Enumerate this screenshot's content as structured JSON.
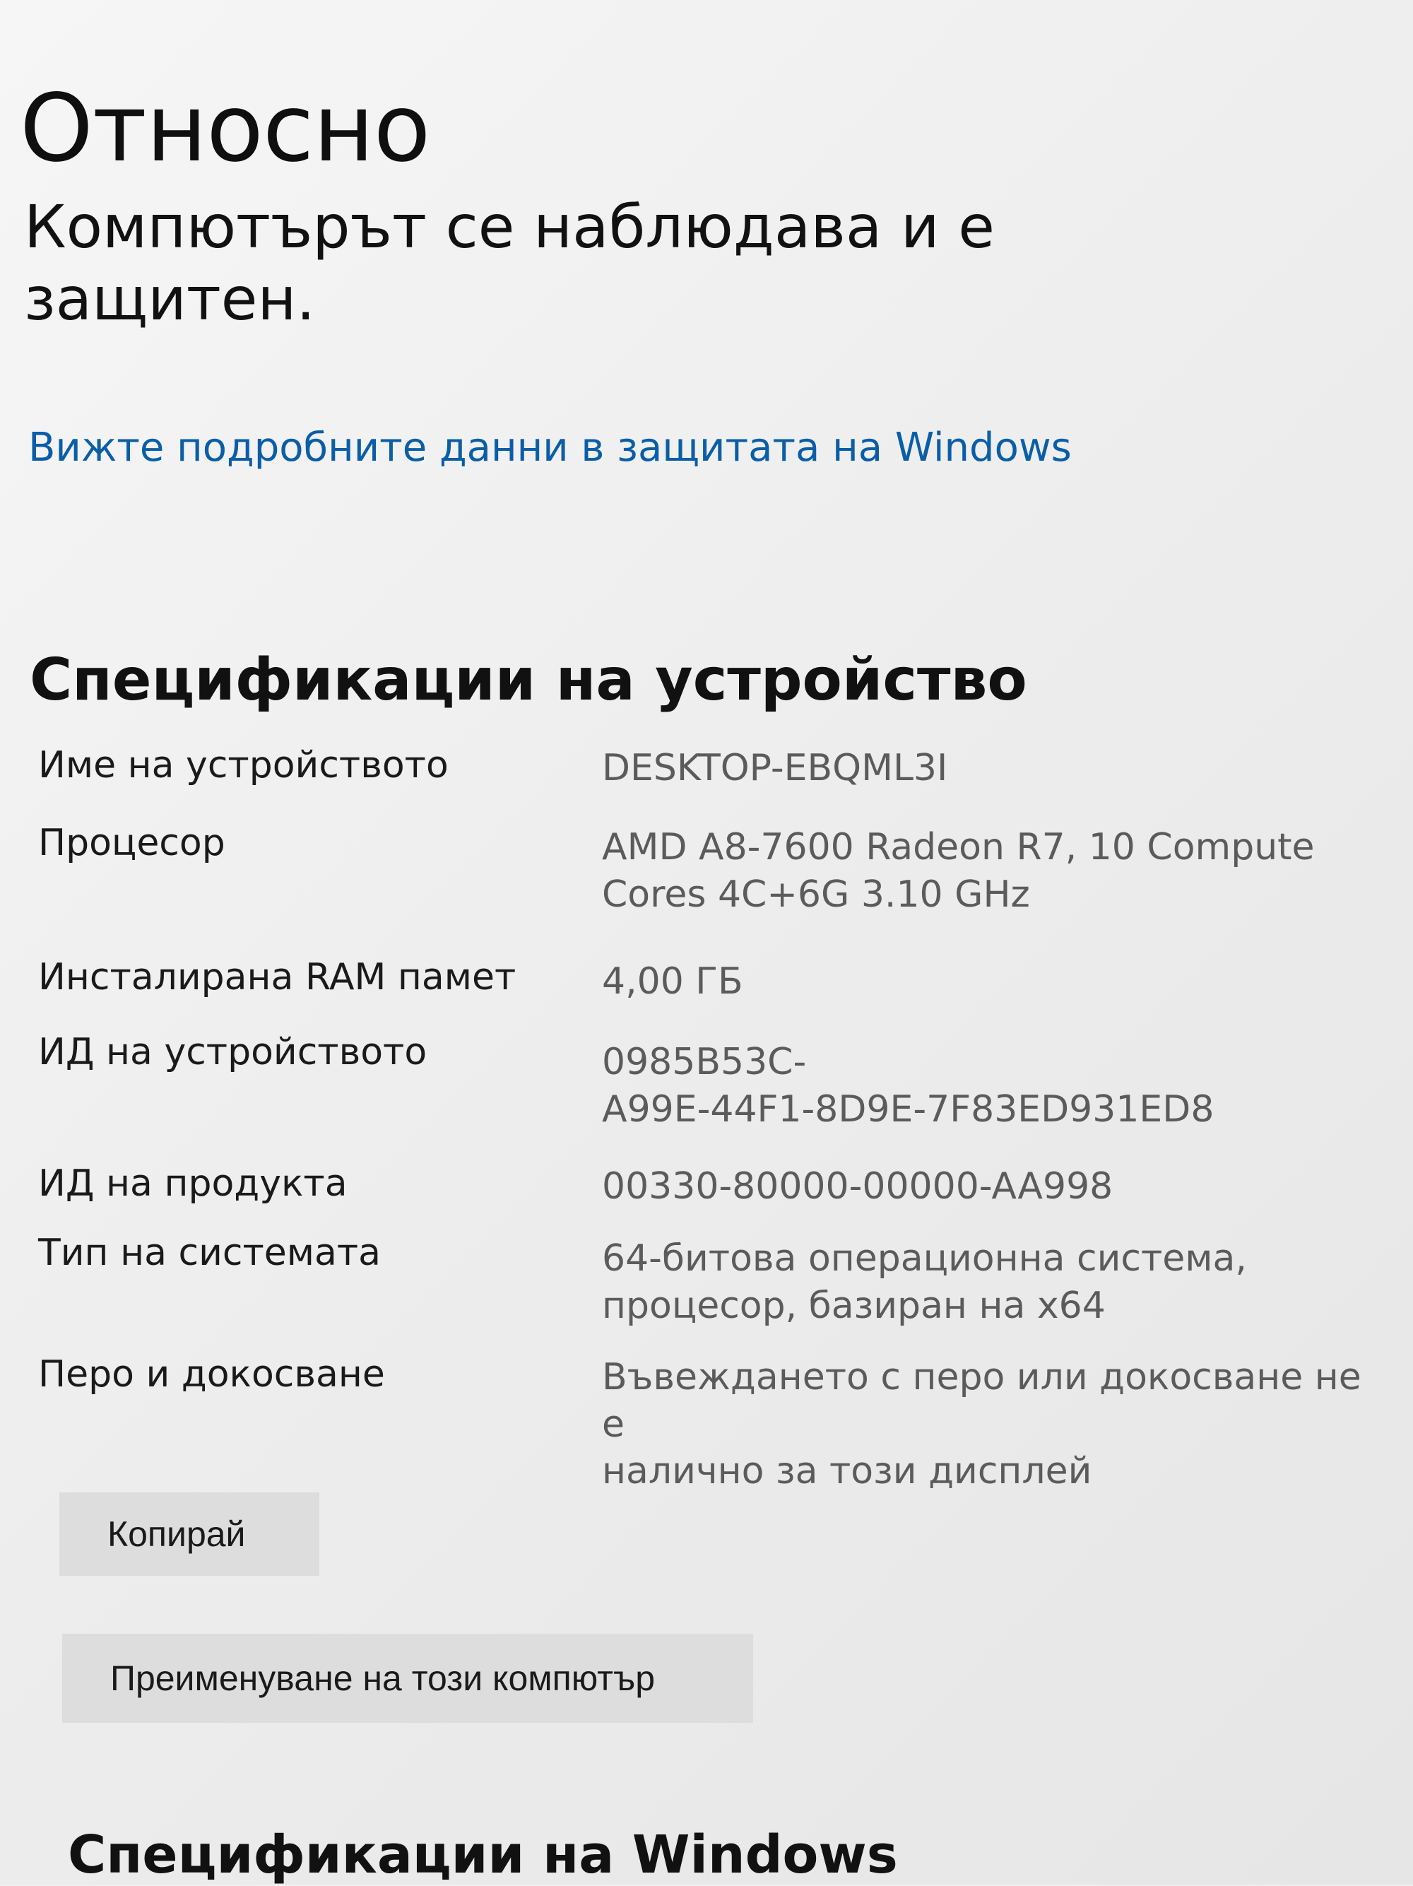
{
  "page": {
    "title": "Относно"
  },
  "status": {
    "message": "Компютърът се наблюдава и е защитен."
  },
  "security_link": {
    "label": "Вижте подробните данни в защитата на Windows"
  },
  "device_specs": {
    "title": "Спецификации на устройство",
    "rows": [
      {
        "label": "Име на устройството",
        "value": "DESKTOP-EBQML3I"
      },
      {
        "label": "Процесор",
        "value": "AMD A8-7600 Radeon R7, 10 Compute\nCores 4C+6G     3.10 GHz"
      },
      {
        "label": "Инсталирана RAM памет",
        "value": "4,00 ГБ"
      },
      {
        "label": "ИД на устройството",
        "value": "0985B53C-\nA99E-44F1-8D9E-7F83ED931ED8"
      },
      {
        "label": "ИД на продукта",
        "value": "00330-80000-00000-AA998"
      },
      {
        "label": "Тип на системата",
        "value": "64-битова операционна система,\nпроцесор, базиран на x64"
      },
      {
        "label": "Перо и докосване",
        "value": "Въвеждането с перо или докосване не е\nналично за този дисплей"
      }
    ]
  },
  "actions": {
    "copy_label": "Копирай",
    "rename_label": "Преименуване на този компютър"
  },
  "windows_specs": {
    "title": "Спецификации на Windows"
  },
  "colors": {
    "background": "#f1f1f1",
    "text": "#111111",
    "secondary_text": "#5b5b5b",
    "link": "#0a5ea8",
    "button_background": "#dddddd"
  }
}
